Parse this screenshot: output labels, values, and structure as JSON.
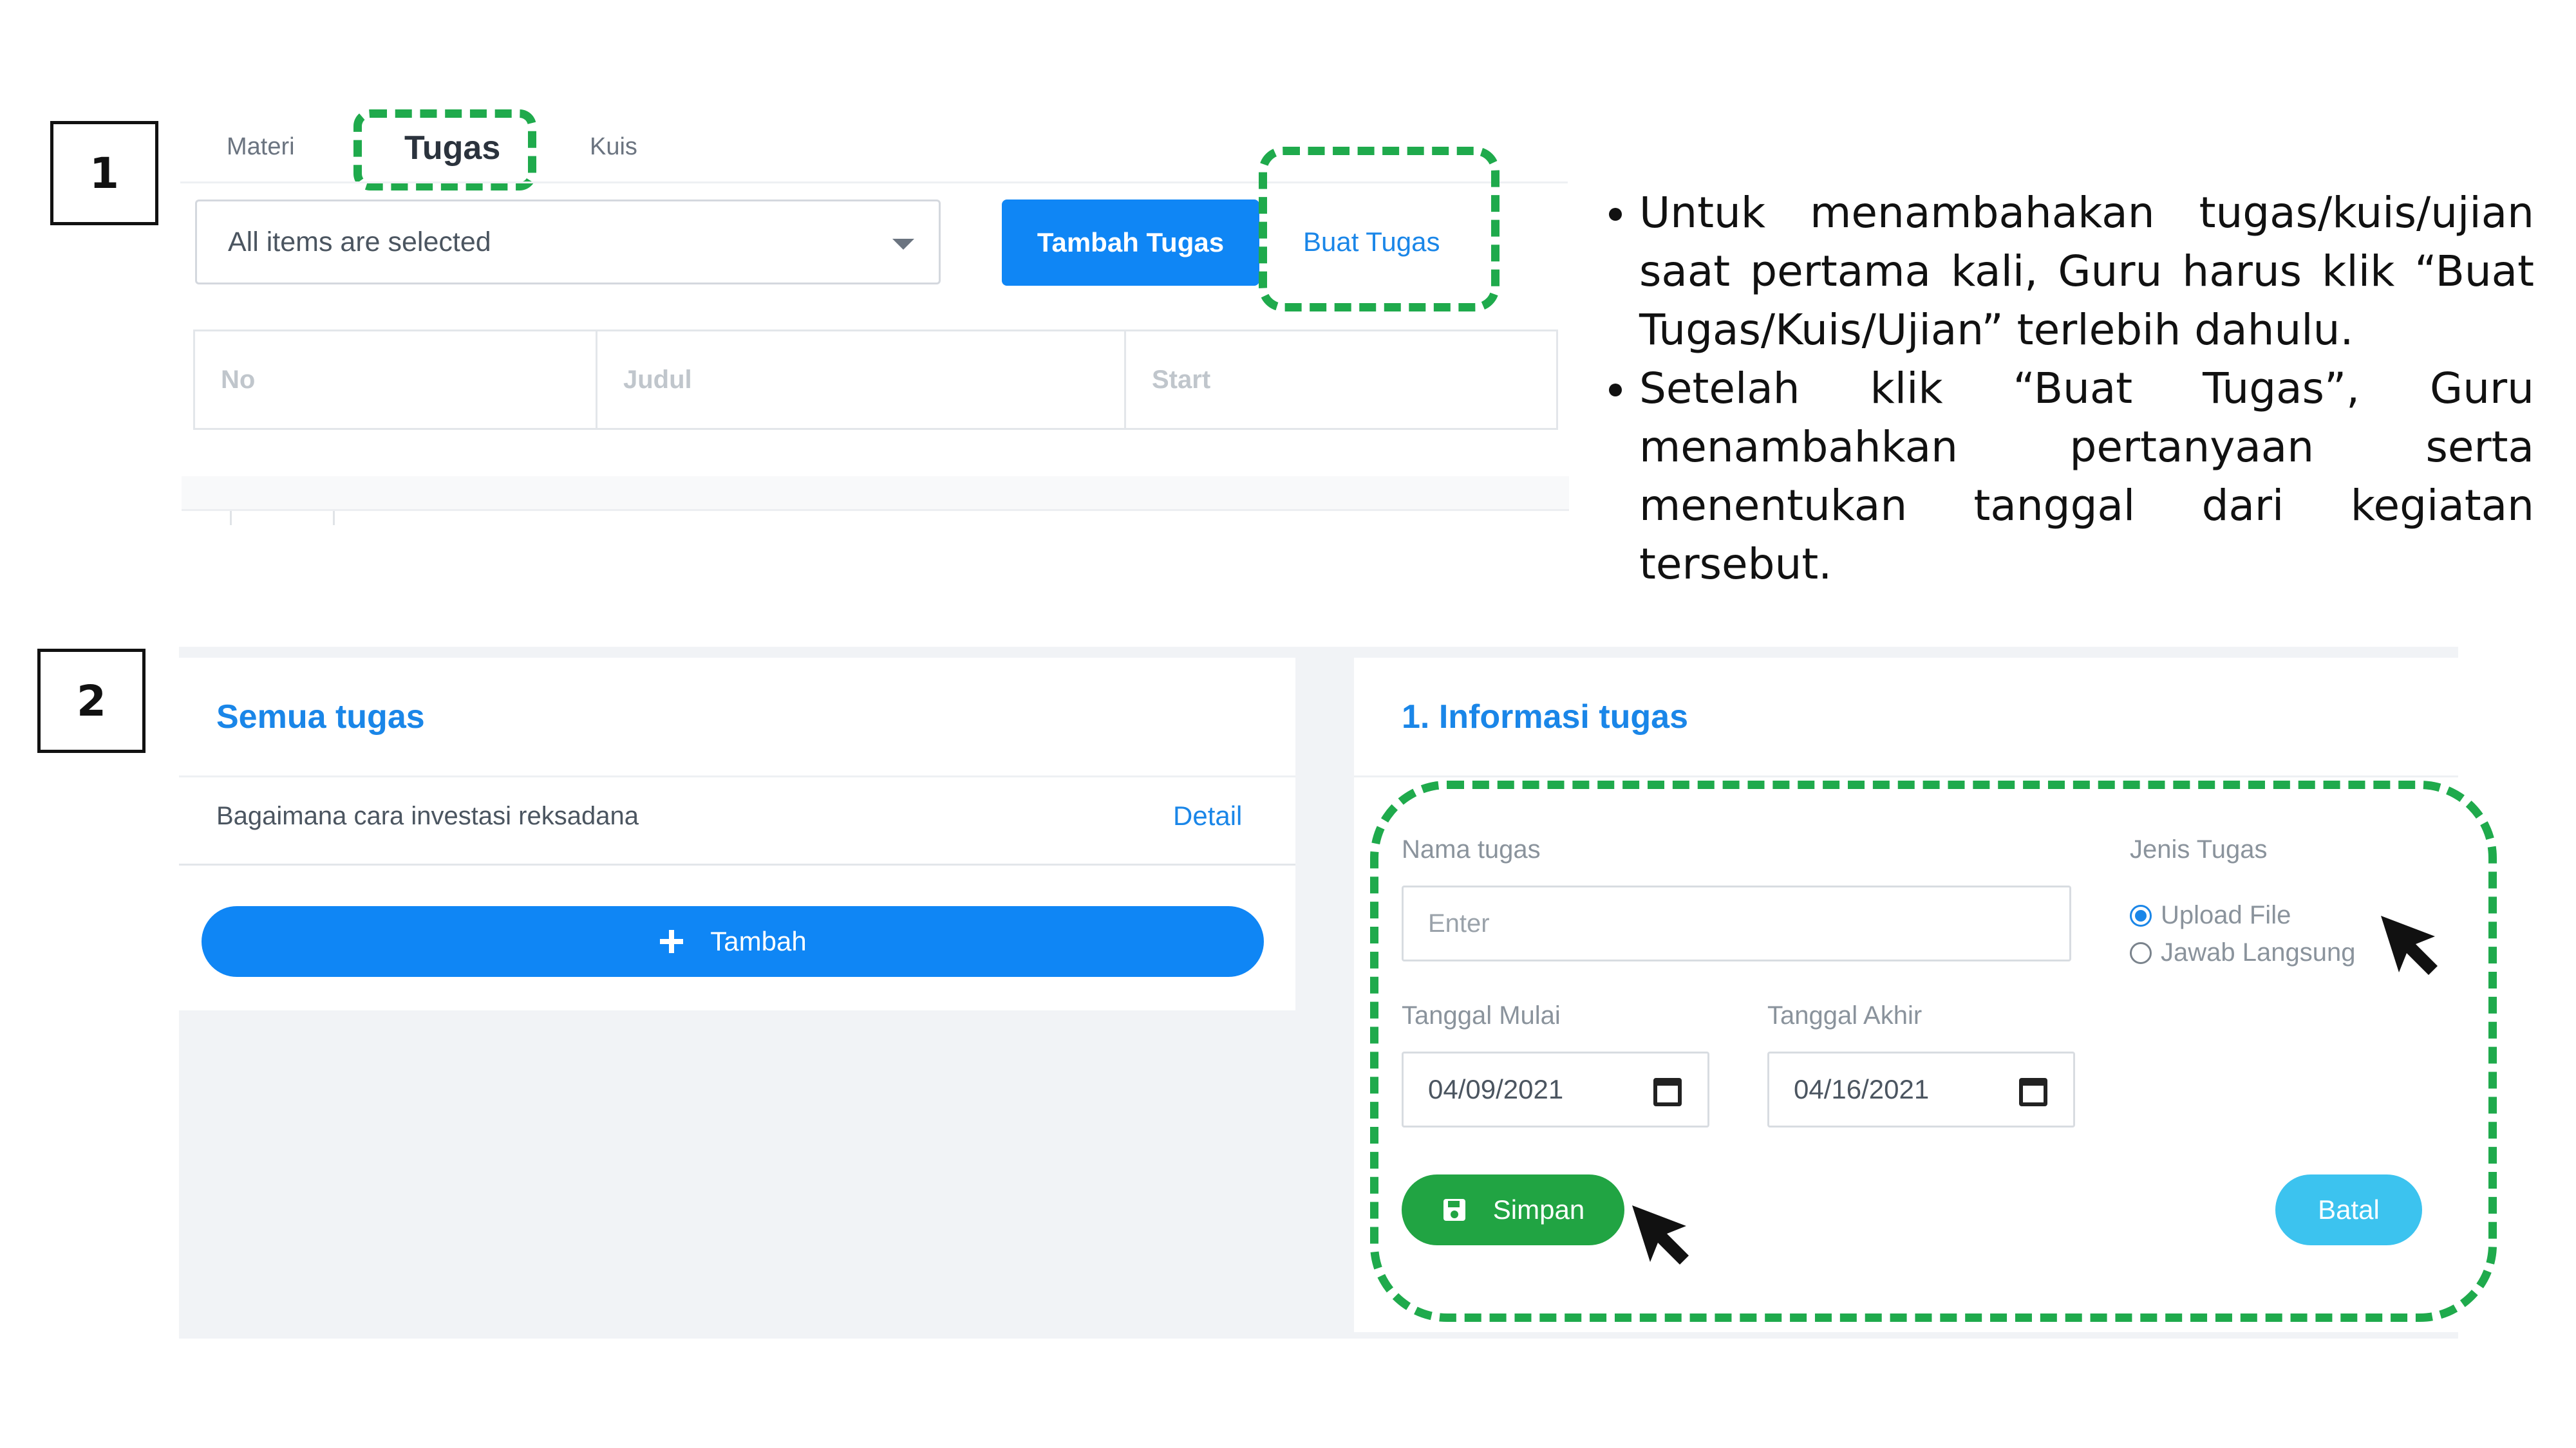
{
  "steps": [
    "1",
    "2"
  ],
  "step1": {
    "tabs": [
      "Materi",
      "Tugas",
      "Kuis"
    ],
    "select_value": "All items are selected",
    "tambah_button": "Tambah Tugas",
    "buat_button": "Buat Tugas",
    "table_headers": [
      "No",
      "Judul",
      "Start"
    ]
  },
  "instructions": [
    "Untuk menambahakan tugas/kuis/ujian saat pertama kali, Guru harus klik “Buat Tugas/Kuis/Ujian” terlebih dahulu.",
    "Setelah klik “Buat Tugas”, Guru menambahkan pertanyaan serta menentukan tanggal dari kegiatan tersebut."
  ],
  "step2": {
    "left": {
      "title": "Semua tugas",
      "item": "Bagaimana cara investasi reksadana",
      "detail_link": "Detail",
      "add_button": "Tambah"
    },
    "right": {
      "title": "1. Informasi tugas",
      "nama_label": "Nama tugas",
      "nama_placeholder": "Enter",
      "jenis_label": "Jenis Tugas",
      "options": [
        "Upload File",
        "Jawab Langsung"
      ],
      "selected_option": "Upload File",
      "mulai_label": "Tanggal Mulai",
      "mulai_value": "04/09/2021",
      "akhir_label": "Tanggal Akhir",
      "akhir_value": "04/16/2021",
      "simpan_button": "Simpan",
      "batal_button": "Batal"
    }
  },
  "colors": {
    "highlight_dash": "#1faa4c",
    "primary_blue": "#0f86f5",
    "link_blue": "#1a86e8",
    "save_green": "#21a443",
    "cancel_cyan": "#3cc3ef"
  },
  "icons": [
    "dropdown-caret-icon",
    "plus-icon",
    "save-icon",
    "calendar-icon",
    "cursor-arrow-icon"
  ]
}
